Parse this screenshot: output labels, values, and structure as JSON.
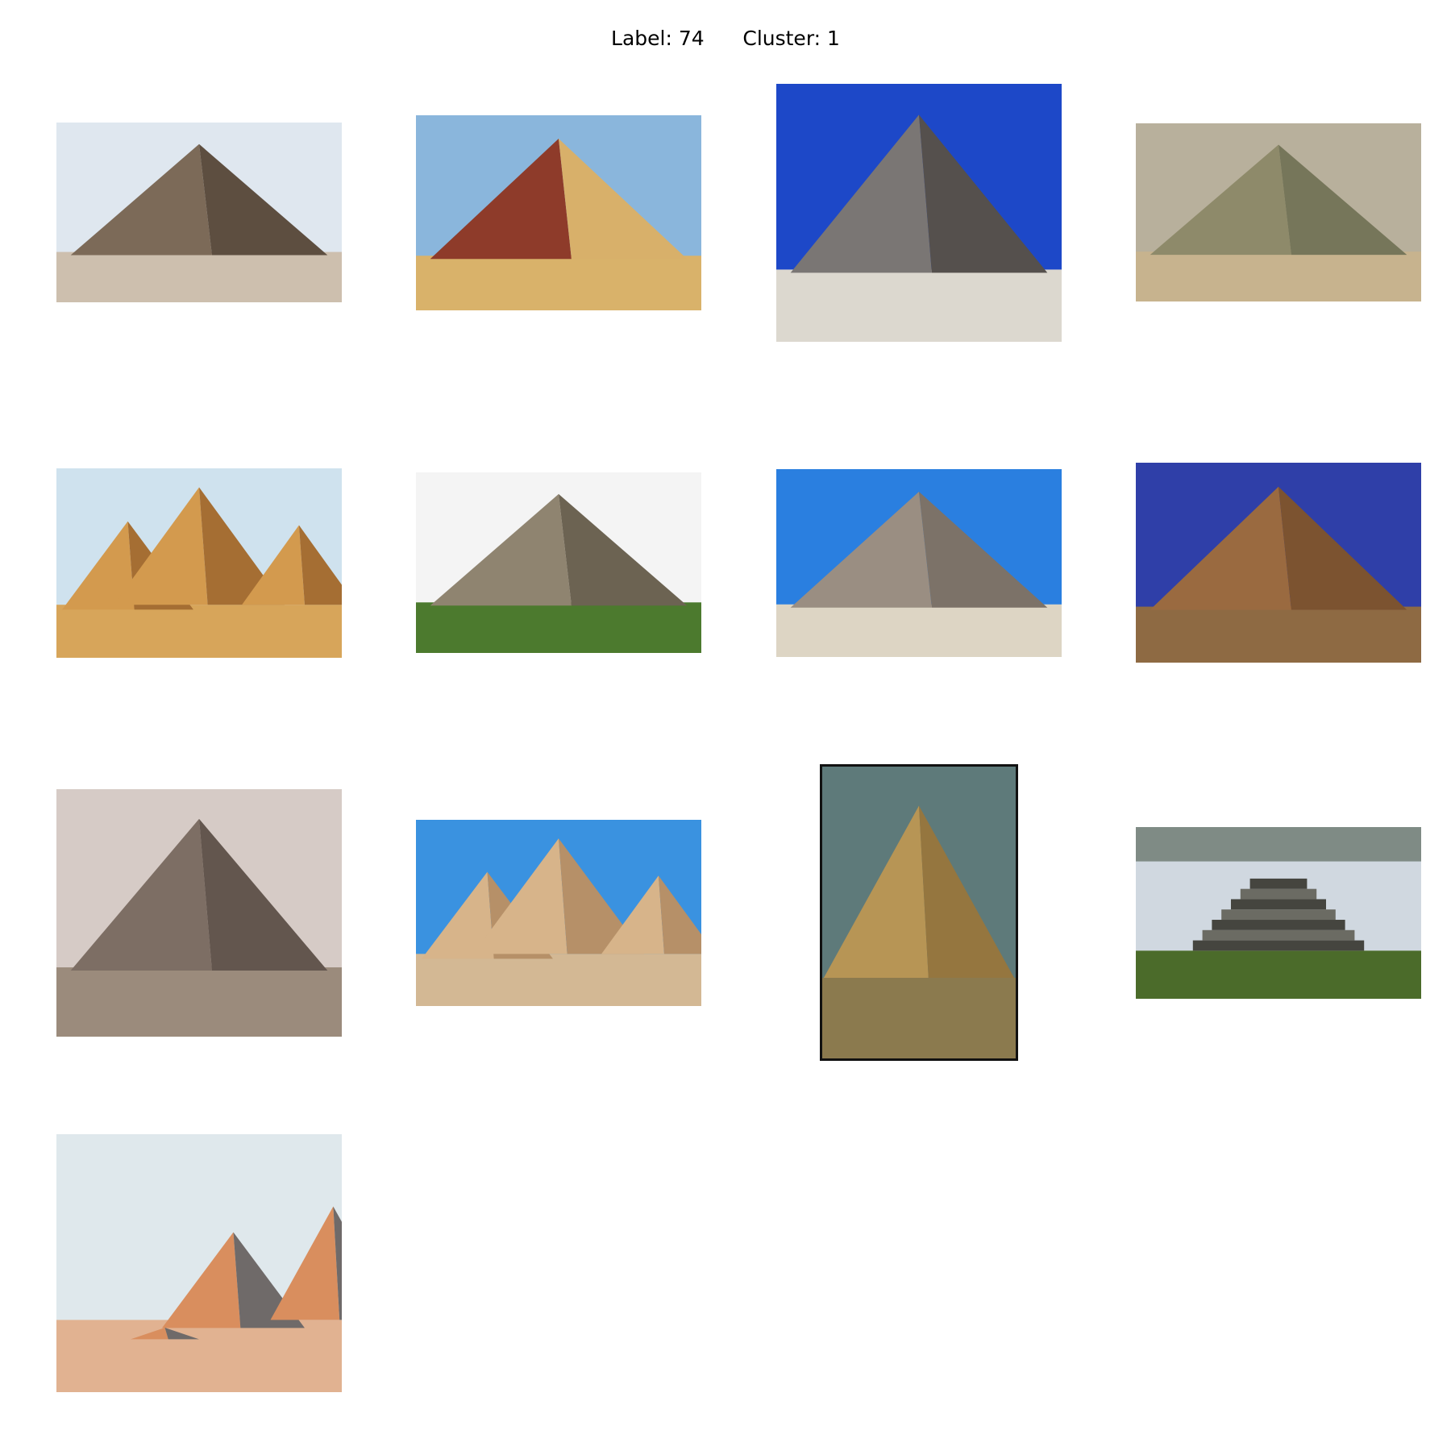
{
  "figure": {
    "label_text": "Label: 74",
    "cluster_text": "Cluster: 1"
  },
  "thumbnails": [
    {
      "scene": "great-pyramid-with-riders",
      "sky": "#dfe7ef",
      "ground": "#cdbfae",
      "pyramid": "#7c6a58",
      "pyramid_shade": "#5d4e40"
    },
    {
      "scene": "red-pyramid-in-dunes",
      "sky": "#8ab6dc",
      "ground": "#d9b26a",
      "pyramid": "#8e3b2a",
      "pyramid_shade": "#d8b06a"
    },
    {
      "scene": "grey-pyramid-blue-sky",
      "sky": "#1d48c8",
      "ground": "#dcd8cf",
      "pyramid": "#7a7674",
      "pyramid_shade": "#55504d"
    },
    {
      "scene": "faded-pyramid-photo",
      "sky": "#b8b09c",
      "ground": "#c7b38e",
      "pyramid": "#8e8a6a",
      "pyramid_shade": "#76765a"
    },
    {
      "scene": "three-giza-pyramids",
      "sky": "#cfe2ee",
      "ground": "#d7a55a",
      "pyramid": "#d39a4e",
      "pyramid_shade": "#a56e33"
    },
    {
      "scene": "stone-cairn-pyramid",
      "sky": "#f4f4f4",
      "ground": "#4c7a2e",
      "pyramid": "#8f8470",
      "pyramid_shade": "#6c6352"
    },
    {
      "scene": "pyramid-behind-sand",
      "sky": "#2a7fe0",
      "ground": "#ddd5c4",
      "pyramid": "#9a8e82",
      "pyramid_shade": "#7c7268"
    },
    {
      "scene": "brown-pyramid-close",
      "sky": "#2f3fa8",
      "ground": "#8e6a43",
      "pyramid": "#9a6a40",
      "pyramid_shade": "#7c5330"
    },
    {
      "scene": "hazy-pyramid-aerial",
      "sky": "#d6cbc6",
      "ground": "#9b8b7c",
      "pyramid": "#7d6e64",
      "pyramid_shade": "#63564e"
    },
    {
      "scene": "three-pyramids-desert",
      "sky": "#3a92e0",
      "ground": "#d3b894",
      "pyramid": "#d7b48a",
      "pyramid_shade": "#b69068"
    },
    {
      "scene": "framed-pyramid-ruins",
      "sky": "#5e7a7a",
      "ground": "#8b7a4e",
      "pyramid": "#b79555",
      "pyramid_shade": "#95763f"
    },
    {
      "scene": "mayan-temple",
      "sky": "#d0d8e0",
      "ground": "#4b6b2a",
      "pyramid": "#6b6b63",
      "pyramid_shade": "#45453f"
    },
    {
      "scene": "pyramids-at-dusk",
      "sky": "#dfe8ec",
      "ground": "#e1b291",
      "pyramid": "#d98e5e",
      "pyramid_shade": "#6f6a69"
    }
  ]
}
